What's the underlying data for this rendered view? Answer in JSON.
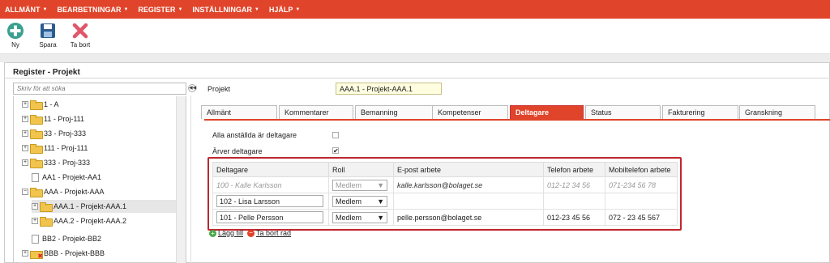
{
  "menu": [
    {
      "label": "ALLMÄNT"
    },
    {
      "label": "BEARBETNINGAR"
    },
    {
      "label": "REGISTER"
    },
    {
      "label": "INSTÄLLNINGAR"
    },
    {
      "label": "HJÄLP"
    }
  ],
  "toolbar": {
    "new_label": "Ny",
    "save_label": "Spara",
    "delete_label": "Ta bort"
  },
  "panel": {
    "title": "Register - Projekt"
  },
  "search": {
    "placeholder": "Skriv för att söka"
  },
  "tree": [
    {
      "label": "1 - A"
    },
    {
      "label": "11 - Proj-111"
    },
    {
      "label": "33 - Proj-333"
    },
    {
      "label": "111 - Proj-111"
    },
    {
      "label": "333 - Proj-333"
    },
    {
      "label": "AA1 - Projekt-AA1"
    },
    {
      "label": "AAA - Projekt-AAA"
    },
    {
      "label": "AAA.1 - Projekt-AAA.1"
    },
    {
      "label": "AAA.2 - Projekt-AAA.2"
    },
    {
      "label": "BB2 - Projekt-BB2"
    },
    {
      "label": "BBB - Projekt-BBB"
    }
  ],
  "form": {
    "project_label": "Projekt",
    "project_value": "AAA.1 - Projekt-AAA.1"
  },
  "tabs": [
    {
      "label": "Allmänt"
    },
    {
      "label": "Kommentarer"
    },
    {
      "label": "Bemanning"
    },
    {
      "label": "Kompetenser"
    },
    {
      "label": "Deltagare"
    },
    {
      "label": "Status"
    },
    {
      "label": "Fakturering"
    },
    {
      "label": "Granskning"
    }
  ],
  "options": {
    "all_employees_label": "Alla anställda är deltagare",
    "inherit_label": "Ärver deltagare"
  },
  "grid": {
    "headers": [
      "Deltagare",
      "Roll",
      "E-post arbete",
      "Telefon arbete",
      "Mobiltelefon arbete"
    ],
    "rows": [
      {
        "participant": "100 - Kalle Karlsson",
        "role": "Medlem",
        "email": "kalle.karlsson@bolaget.se",
        "phone": "012-12 34 56",
        "mobile": "071-234 56 78"
      },
      {
        "participant": "102 - Lisa Larsson",
        "role": "Medlem",
        "email": "",
        "phone": "",
        "mobile": ""
      },
      {
        "participant": "101 - Pelle Persson",
        "role": "Medlem",
        "email": "pelle.persson@bolaget.se",
        "phone": "012-23 45 56",
        "mobile": "072 - 23 45 567"
      }
    ]
  },
  "actions": {
    "add_label": "Lägg till",
    "delete_row_label": "Ta bort rad"
  },
  "colors": {
    "accent": "#e0442a",
    "highlight_border": "#c0262d"
  }
}
